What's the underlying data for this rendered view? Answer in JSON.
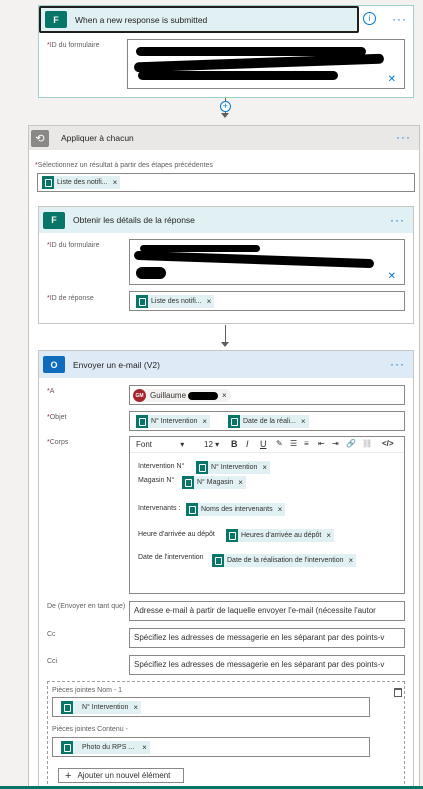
{
  "trigger": {
    "title": "When a new response is submitted",
    "form_id_label": "ID du formulaire"
  },
  "apply_each": {
    "title": "Appliquer à chacun",
    "select_label": "Sélectionnez un résultat à partir des étapes précédentes",
    "chip": "Liste des notifi..."
  },
  "get_details": {
    "title": "Obtenir les détails de la réponse",
    "form_id_label": "ID du formulaire",
    "response_id_label": "ID de réponse",
    "chip": "Liste des notifi..."
  },
  "send_email": {
    "title": "Envoyer un e-mail (V2)",
    "to_label": "A",
    "to_avatar": "GM",
    "to_value": "Guillaume",
    "subject_label": "Objet",
    "subject_chips": [
      "N° Intervention",
      "Date de la réali..."
    ],
    "body_label": "Corps",
    "font_name": "Font",
    "font_size": "12",
    "body_lines": [
      {
        "text": "Intervention N°",
        "chip": "N° Intervention"
      },
      {
        "text": "Magasin N°",
        "chip": "N° Magasin"
      },
      {
        "text": "Intervenants :",
        "chip": "Noms des intervenants"
      },
      {
        "text": "Heure d'arrivée au dépôt",
        "chip": "Heures d'arrivée au dépôt"
      },
      {
        "text": "Date de l'intervention",
        "chip": "Date de la réalisation de l'intervention"
      }
    ],
    "from_label": "De (Envoyer en tant que)",
    "from_placeholder": "Adresse e-mail à partir de laquelle envoyer l'e-mail (nécessite l'autor",
    "cc_label": "Cc",
    "cc_placeholder": "Spécifiez les adresses de messagerie en les séparant par des points-v",
    "bcc_label": "Cci",
    "bcc_placeholder": "Spécifiez les adresses de messagerie en les séparant par des points-v",
    "attach_name_label": "Pièces jointes Nom - 1",
    "attach_name_chip": "N° Intervention",
    "attach_content_label": "Pièces jointes Contenu -",
    "attach_content_chip": "Photo du RPS ...",
    "add_item_label": "Ajouter un nouvel élément"
  },
  "colors": {
    "forms_green": "#077568",
    "outlook_blue": "#0f6cbd",
    "accent": "#0078d4",
    "required": "#a4262c"
  },
  "icons": [
    "forms-icon",
    "info-icon",
    "more-icon",
    "close-icon",
    "loop-icon",
    "outlook-icon",
    "trash-icon",
    "plus-icon",
    "add-step-icon"
  ]
}
